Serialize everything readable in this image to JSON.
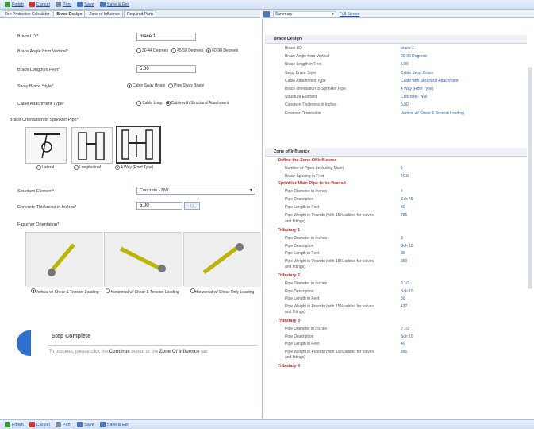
{
  "toolbar": {
    "buttons": [
      {
        "label": "Finish",
        "icon": "finish-icon"
      },
      {
        "label": "Cancel",
        "icon": "cancel-icon"
      },
      {
        "label": "Print",
        "icon": "print-icon"
      },
      {
        "label": "Save",
        "icon": "save-icon"
      },
      {
        "label": "Save & Exit",
        "icon": "save-exit-icon"
      }
    ]
  },
  "tabs": [
    {
      "label": "Fire Protection Calculator",
      "active": false
    },
    {
      "label": "Brace Design",
      "active": true
    },
    {
      "label": "Zone of Influence",
      "active": false
    },
    {
      "label": "Required Parts",
      "active": false
    }
  ],
  "summary_bar": {
    "select_value": "Summary",
    "link": "Full Screen"
  },
  "form": {
    "brace_id_label": "Brace I.D.*",
    "brace_id_value": "brace 1",
    "angle_label": "Brace Angle from Vertical*",
    "angle_options": [
      "30-44 Degrees",
      "45-59 Degrees",
      "60-90 Degrees"
    ],
    "length_label": "Brace Length in Feet*",
    "length_value": "5.00",
    "style_label": "Sway Brace Style*",
    "style_options": [
      "Cable Sway Brace",
      "Pipe Sway Brace"
    ],
    "cable_label": "Cable Attachment Type*",
    "cable_options": [
      "Cable Loop",
      "Cable with Structural Attachment"
    ],
    "orientation_label": "Brace Orientation to Sprinkler Pipe*",
    "orientation_options": [
      "Lateral",
      "Longitudinal",
      "4 Way (Roof Type)"
    ],
    "structure_label": "Structure Element*",
    "structure_value": "Concrete - NW",
    "concrete_label": "Concrete Thickness in Inches*",
    "concrete_value": "5.00",
    "fastener_label": "Fastener Orientation*",
    "fastener_options": [
      "Vertical w/ Shear & Tension Loading",
      "Horizontal w/ Shear & Tension Loading",
      "Horizontal w/ Shear Only Loading"
    ]
  },
  "step": {
    "title": "Step Complete",
    "text_prefix": "To proceed, please click the",
    "continue_word": "Continue",
    "text_middle": "button or the",
    "zone_word": "Zone Of Influence",
    "text_suffix": "tab"
  },
  "summary": {
    "brace_design_title": "Brace Design",
    "brace_rows": [
      {
        "key": "Brace I.D.",
        "val": "brace 1"
      },
      {
        "key": "Brace Angle from Vertical",
        "val": "60-90 Degrees"
      },
      {
        "key": "Brace Length in Feet",
        "val": "5.00"
      },
      {
        "key": "Sway Brace Style",
        "val": "Cable Sway Brace"
      },
      {
        "key": "Cable Attachment Type",
        "val": "Cable with Structural Attachment"
      },
      {
        "key": "Brace Orientation to Sprinkler Pipe",
        "val": "4 Way (Roof Type)"
      },
      {
        "key": "Structure Element",
        "val": "Concrete - NW"
      },
      {
        "key": "Concrete Thickness in Inches",
        "val": "5.00"
      },
      {
        "key": "Fastener Orientation",
        "val": "Vertical w/ Shear & Tension Loading"
      }
    ],
    "zone_title": "Zone of Influence",
    "define_title": "Define the Zone Of Influence",
    "define_rows": [
      {
        "key": "Number of Pipes (Including Main)",
        "val": "5"
      },
      {
        "key": "Brace Spacing in Feet",
        "val": "40.0"
      }
    ],
    "main_title": "Sprinkler Main Pipe to be Braced",
    "main_rows": [
      {
        "key": "Pipe Diameter in Inches",
        "val": "4"
      },
      {
        "key": "Pipe Description",
        "val": "Sch 40"
      },
      {
        "key": "Pipe Length in Feet",
        "val": "40"
      },
      {
        "key": "Pipe Weight in Pounds (with 15% added for valves",
        "val": "785"
      }
    ],
    "fittings_label": "and fittings)",
    "tributaries": [
      {
        "title": "Tributary 1",
        "rows": [
          {
            "key": "Pipe Diameter in Inches",
            "val": "3"
          },
          {
            "key": "Pipe Description",
            "val": "Sch 10"
          },
          {
            "key": "Pipe Length in Feet",
            "val": "30"
          },
          {
            "key": "Pipe Weight in Pounds (with 15% added for valves",
            "val": "360"
          }
        ]
      },
      {
        "title": "Tributary 2",
        "rows": [
          {
            "key": "Pipe Diameter in Inches",
            "val": "2 1/2"
          },
          {
            "key": "Pipe Description",
            "val": "Sch 10"
          },
          {
            "key": "Pipe Length in Feet",
            "val": "50"
          },
          {
            "key": "Pipe Weight in Pounds (with 15% added for valves",
            "val": "437"
          }
        ]
      },
      {
        "title": "Tributary 3",
        "rows": [
          {
            "key": "Pipe Diameter in Inches",
            "val": "2 1/2"
          },
          {
            "key": "Pipe Description",
            "val": "Sch 10"
          },
          {
            "key": "Pipe Length in Feet",
            "val": "40"
          },
          {
            "key": "Pipe Weight in Pounds (with 15% added for valves",
            "val": "361"
          }
        ]
      }
    ],
    "tributary4_title": "Tributary 4"
  }
}
